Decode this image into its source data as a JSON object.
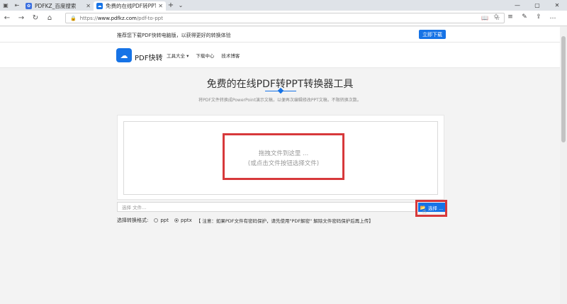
{
  "browser": {
    "tabs": [
      {
        "title": "PDFKZ_百度搜索",
        "active": false,
        "icon": "paw-icon",
        "icon_color": "#3b6fe0"
      },
      {
        "title": "免费的在线PDF转PPT -",
        "active": true,
        "icon": "cloud-icon",
        "icon_color": "#1673e6"
      }
    ],
    "url_scheme": "https://",
    "url_host": "www.pdfkz.com",
    "url_path": "/pdf-to-ppt"
  },
  "promo": {
    "text": "推荐您下载PDF快转电脑版，以获得更好的转换体验",
    "button": "立即下载"
  },
  "site": {
    "brand": "PDF快转",
    "menu": [
      "工具大全 ▾",
      "下载中心",
      "技术博客"
    ]
  },
  "hero": {
    "title": "免费的在线PDF转PPT转换器工具",
    "subtitle": "将PDF文件转换成PowerPoint演示文稿，以便再次编辑修改PPT文稿，不限转换次数。"
  },
  "upload": {
    "drop_line1": "拖拽文件到这里 ...",
    "drop_line2": "(或点击文件按钮选择文件)",
    "file_placeholder": "选择 文件...",
    "choose_button": "选择 ..."
  },
  "format": {
    "label": "选择转换格式:",
    "options": [
      "ppt",
      "pptx"
    ],
    "selected": "pptx",
    "note": "【 注意：如果PDF文件有密码保护，请先使用\"PDF解密\" 解除文件密码保护后再上传】"
  },
  "colors": {
    "accent": "#1673e6",
    "highlight": "#d7393b"
  }
}
